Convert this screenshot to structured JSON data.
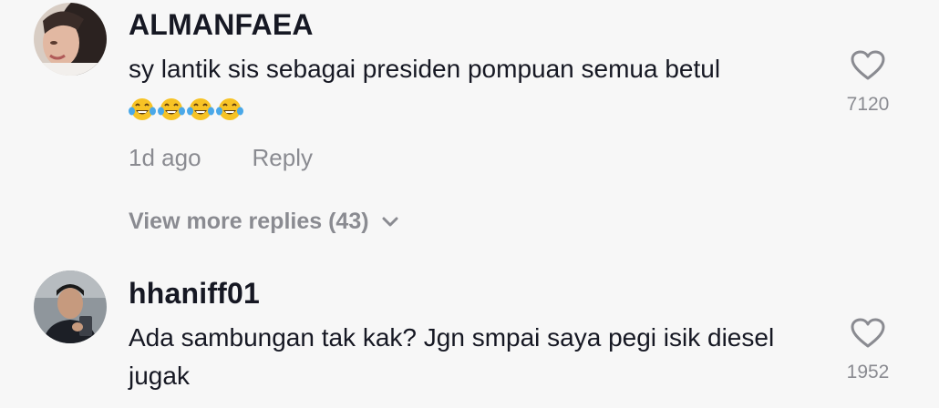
{
  "comments": [
    {
      "username": "ALMANFAEA",
      "text": "sy lantik sis sebagai presiden pompuan semua betul",
      "emoji_icon": "face-with-tears-of-joy-icon",
      "emoji_count": 4,
      "time": "1d ago",
      "reply_label": "Reply",
      "like_count": "7120",
      "view_more": "View more replies (43)"
    },
    {
      "username": "hhaniff01",
      "text": "Ada sambungan tak kak? Jgn smpai saya pegi isik diesel jugak",
      "like_count": "1952"
    }
  ],
  "colors": {
    "background": "#f7f7f7",
    "primary_text": "#161823",
    "secondary_text": "#8a8b91"
  }
}
